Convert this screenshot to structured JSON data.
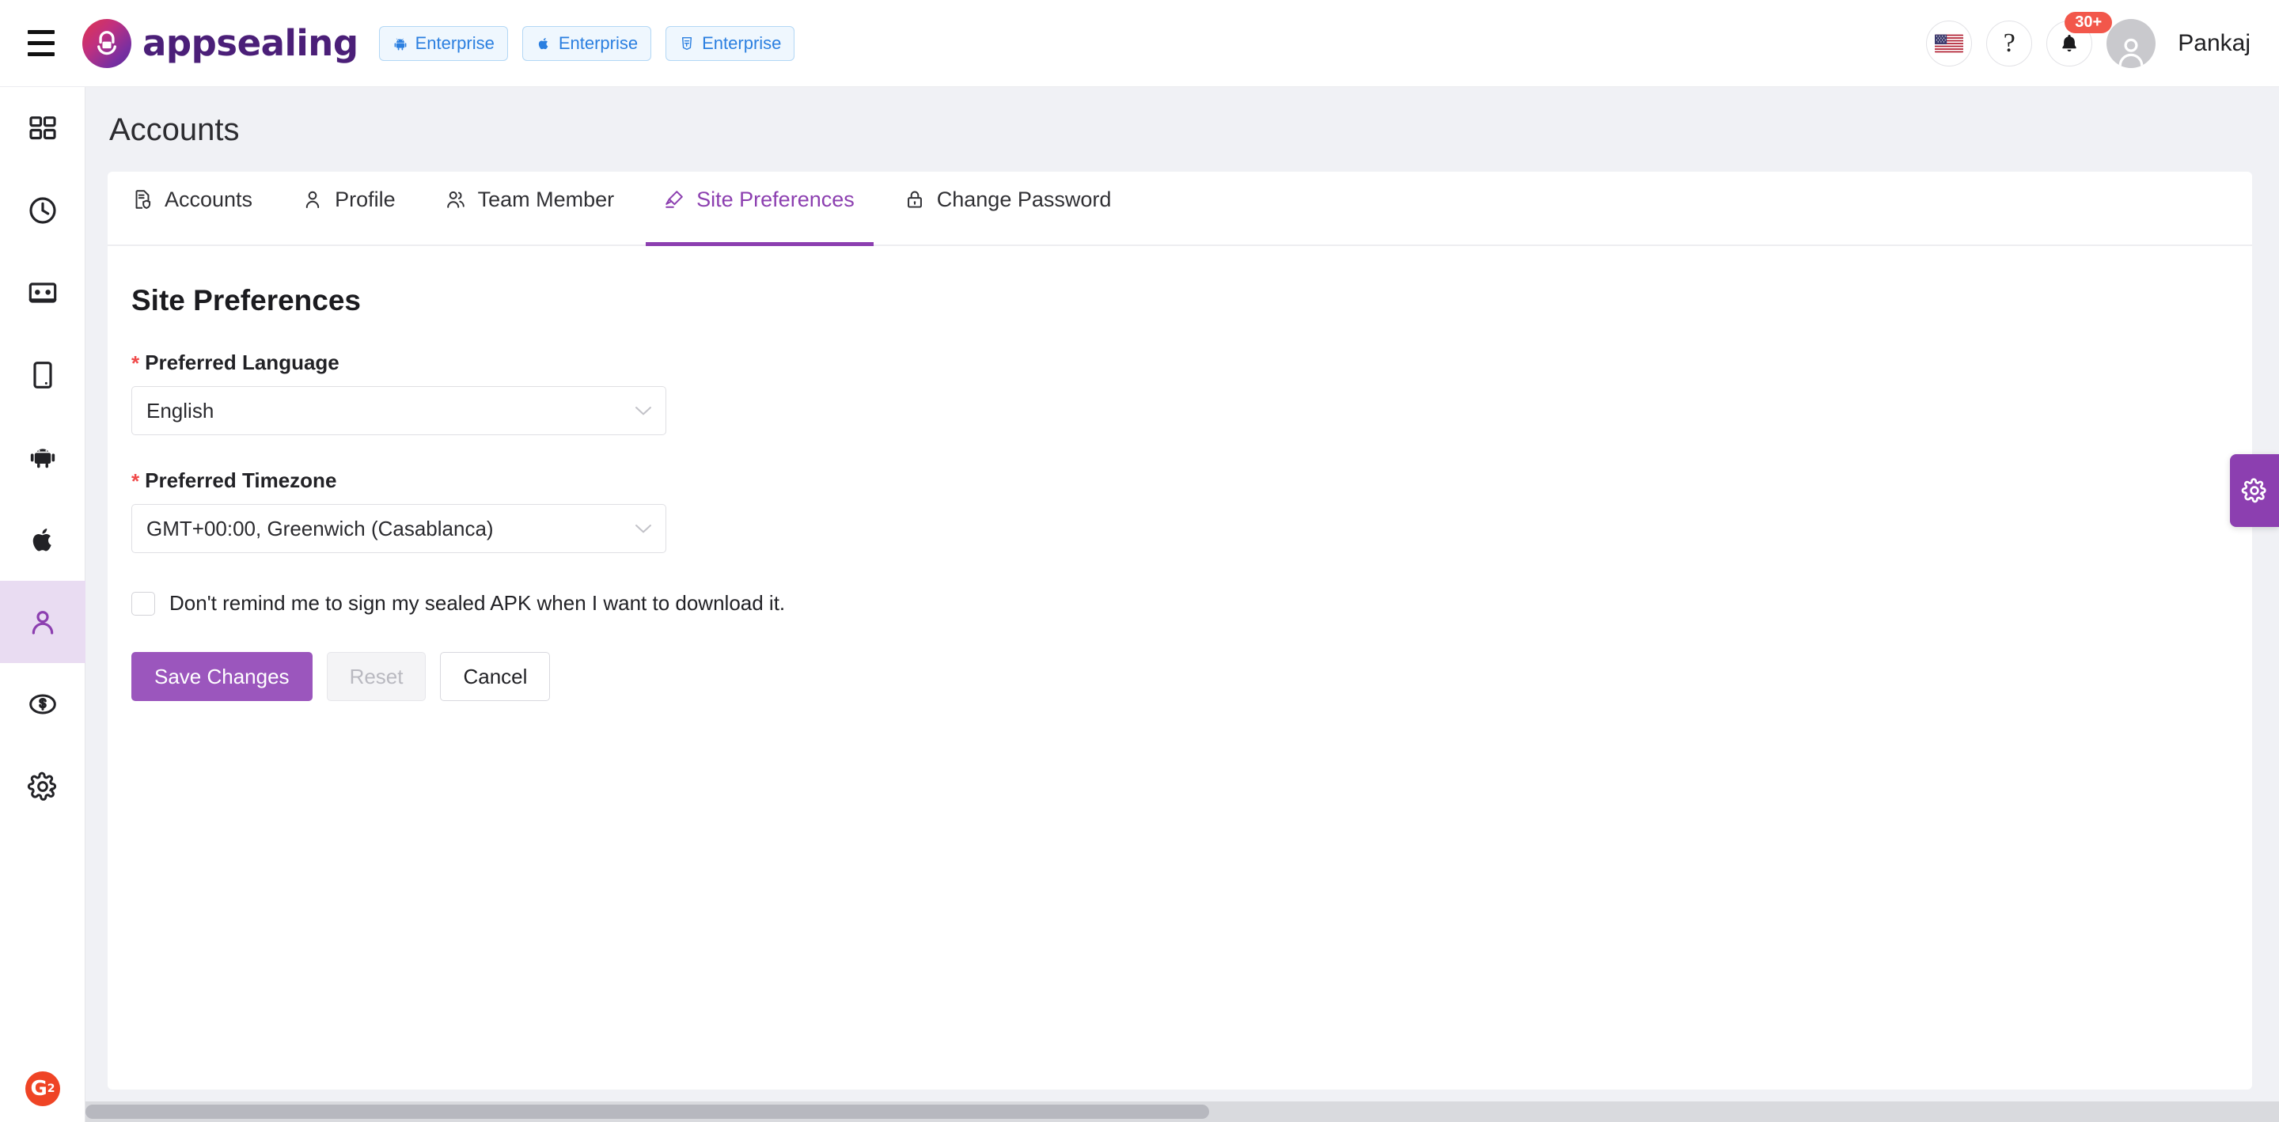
{
  "header": {
    "menu_icon": "hamburger-icon",
    "brand_name": "appsealing",
    "badges": [
      {
        "icon": "android-icon",
        "label": "Enterprise"
      },
      {
        "icon": "apple-icon",
        "label": "Enterprise"
      },
      {
        "icon": "html5-icon",
        "label": "Enterprise"
      }
    ],
    "language_flag": "us-flag-icon",
    "help_icon": "question-mark-icon",
    "notification_icon": "bell-icon",
    "notification_count": "30+",
    "avatar_icon": "user-avatar-icon",
    "username": "Pankaj"
  },
  "sidebar": {
    "items": [
      {
        "icon": "dashboard-grid-icon",
        "active": false
      },
      {
        "icon": "clock-history-icon",
        "active": false
      },
      {
        "icon": "id-card-icon",
        "active": false
      },
      {
        "icon": "mobile-device-icon",
        "active": false
      },
      {
        "icon": "android-icon",
        "active": false
      },
      {
        "icon": "apple-icon",
        "active": false
      },
      {
        "icon": "user-icon",
        "active": true
      },
      {
        "icon": "dollar-icon",
        "active": false
      },
      {
        "icon": "gear-icon",
        "active": false
      }
    ],
    "g2_badge": "G",
    "g2_sup": "2"
  },
  "page": {
    "title": "Accounts"
  },
  "tabs": [
    {
      "label": "Accounts",
      "icon": "document-shield-icon",
      "active": false
    },
    {
      "label": "Profile",
      "icon": "person-icon",
      "active": false
    },
    {
      "label": "Team Member",
      "icon": "people-icon",
      "active": false
    },
    {
      "label": "Site Preferences",
      "icon": "highlighter-pen-icon",
      "active": true
    },
    {
      "label": "Change Password",
      "icon": "lock-icon",
      "active": false
    }
  ],
  "site_preferences": {
    "heading": "Site Preferences",
    "required_marker": "*",
    "language": {
      "label": "Preferred Language",
      "value": "English",
      "chevron": "chevron-down-icon"
    },
    "timezone": {
      "label": "Preferred Timezone",
      "value": "GMT+00:00, Greenwich (Casablanca)",
      "chevron": "chevron-down-icon"
    },
    "reminder_checkbox": {
      "label": "Don't remind me to sign my sealed APK when I want to download it.",
      "checked": false
    },
    "buttons": {
      "save": "Save Changes",
      "reset": "Reset",
      "cancel": "Cancel"
    }
  },
  "floating": {
    "settings_tab_icon": "gear-icon"
  },
  "colors": {
    "accent_purple": "#8c3fb0",
    "primary_button": "#9b56bd",
    "badge_blue": "#2b7fe0",
    "notif_red": "#f2574b",
    "required_red": "#f04a4a",
    "page_bg": "#f0f1f5"
  }
}
